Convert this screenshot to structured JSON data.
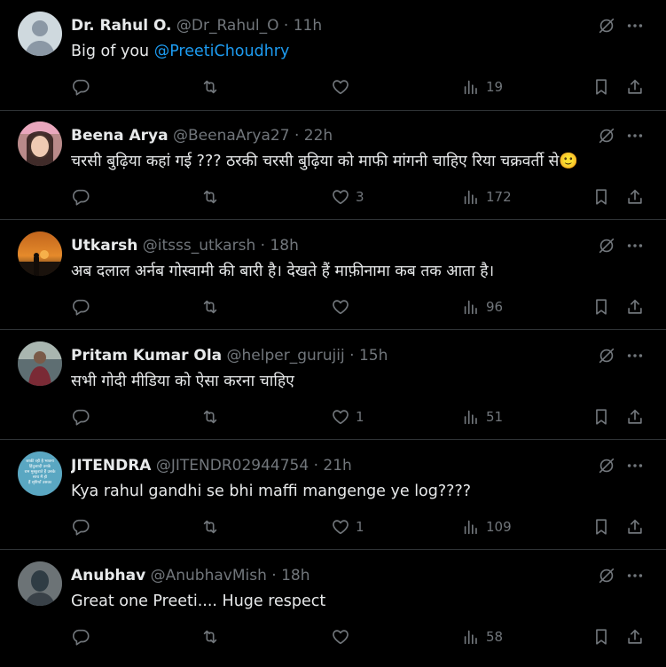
{
  "replies": [
    {
      "name": "Dr. Rahul O.",
      "handle": "@Dr_Rahul_O",
      "time": "11h",
      "text": "Big of you ",
      "mention": "@PreetiChoudhry",
      "likes": "",
      "views": "19",
      "avatar": "default"
    },
    {
      "name": "Beena Arya",
      "handle": "@BeenaArya27",
      "time": "22h",
      "text": "चरसी बुढ़िया कहां गई ??? ठरकी चरसी बुढ़िया को माफी मांगनी चाहिए रिया चक्रवर्ती से🙂",
      "mention": "",
      "likes": "3",
      "views": "172",
      "avatar": "photo-woman"
    },
    {
      "name": "Utkarsh",
      "handle": "@itsss_utkarsh",
      "time": "18h",
      "text": "अब दलाल अर्नब गोस्वामी की बारी है। देखते हैं माफ़ीनामा कब तक आता है।",
      "mention": "",
      "likes": "",
      "views": "96",
      "avatar": "photo-sunset"
    },
    {
      "name": "Pritam Kumar Ola",
      "handle": "@helper_gurujij",
      "time": "15h",
      "text": "सभी गोदी मीडिया को ऐसा करना चाहिए",
      "mention": "",
      "likes": "1",
      "views": "51",
      "avatar": "photo-man"
    },
    {
      "name": "JITENDRA",
      "handle": "@JITENDR02944754",
      "time": "21h",
      "text": "Kya rahul gandhi se bhi maffi mangenge ye log????",
      "mention": "",
      "likes": "1",
      "views": "109",
      "avatar": "text-badge",
      "avatar_text": [
        "जाकी रही है भावना",
        "हिंदुत्वादी उनके",
        "राम मुस्कुराते हैं उसके",
        "साथ मैं ही",
        "हैं सृष्टियाँ उसका"
      ]
    },
    {
      "name": "Anubhav",
      "handle": "@AnubhavMish",
      "time": "18h",
      "text": "Great one Preeti.... Huge respect",
      "mention": "",
      "likes": "",
      "views": "58",
      "avatar": "photo-portrait"
    }
  ],
  "colors": {
    "background": "#000000",
    "text": "#e7e9ea",
    "muted": "#71767b",
    "link": "#1d9bf0",
    "divider": "#2f3336"
  },
  "icons": [
    "reply-icon",
    "retweet-icon",
    "like-icon",
    "views-icon",
    "bookmark-icon",
    "share-icon",
    "grok-icon",
    "more-icon"
  ]
}
